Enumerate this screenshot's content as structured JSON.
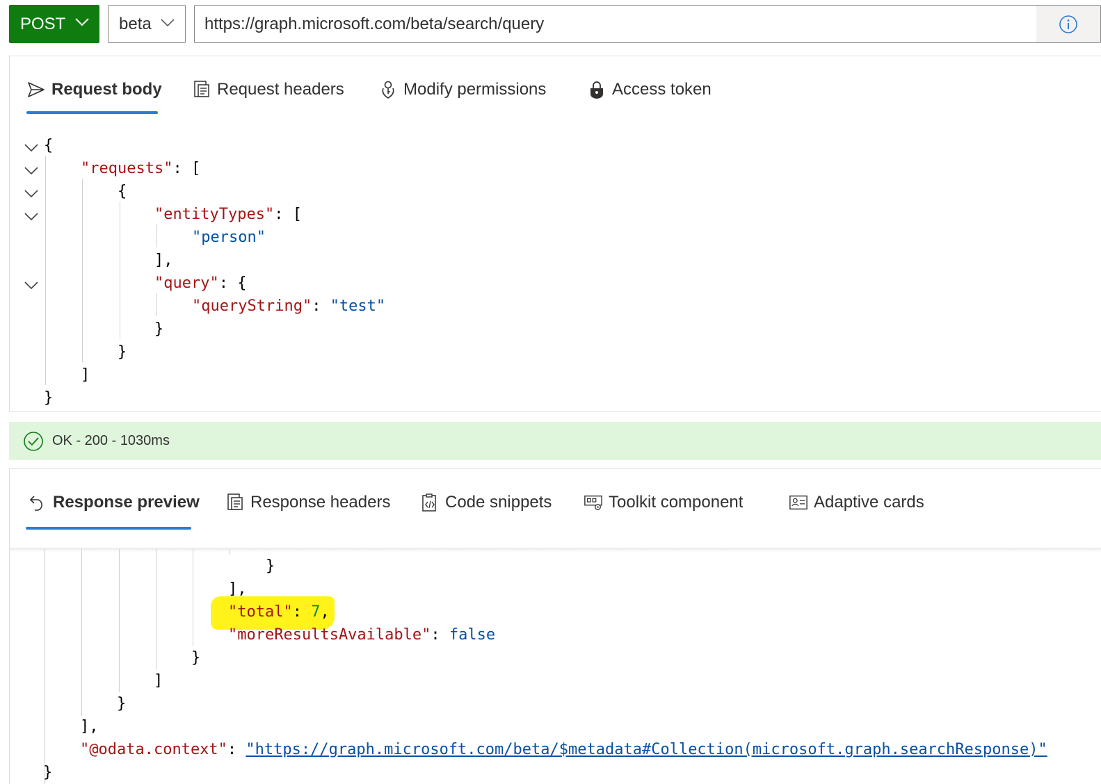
{
  "toolbar": {
    "method": "POST",
    "version": "beta",
    "url": "https://graph.microsoft.com/beta/search/query",
    "info_icon": "info-icon"
  },
  "request": {
    "tabs": [
      {
        "label": "Request body",
        "icon": "send-icon",
        "active": true
      },
      {
        "label": "Request headers",
        "icon": "document-list-icon",
        "active": false
      },
      {
        "label": "Modify permissions",
        "icon": "key-icon",
        "active": false
      },
      {
        "label": "Access token",
        "icon": "lock-icon",
        "active": false
      }
    ],
    "body_lines": [
      {
        "key": "",
        "sep": "",
        "val": "{"
      },
      {
        "key": "\"requests\"",
        "sep": ": ",
        "val": "["
      },
      {
        "key": "",
        "sep": "",
        "val": "{"
      },
      {
        "key": "\"entityTypes\"",
        "sep": ": ",
        "val": "["
      },
      {
        "key": "",
        "sep": "",
        "val": "\"person\""
      },
      {
        "key": "",
        "sep": "",
        "val": "],"
      },
      {
        "key": "\"query\"",
        "sep": ": ",
        "val": "{"
      },
      {
        "key": "\"queryString\"",
        "sep": ": ",
        "val": "\"test\""
      },
      {
        "key": "",
        "sep": "",
        "val": "}"
      },
      {
        "key": "",
        "sep": "",
        "val": "}"
      },
      {
        "key": "",
        "sep": "",
        "val": "]"
      },
      {
        "key": "",
        "sep": "",
        "val": "}"
      }
    ]
  },
  "status": {
    "text": "OK - 200 - 1030ms",
    "color": "#dff6dd"
  },
  "response": {
    "tabs": [
      {
        "label": "Response preview",
        "icon": "undo-arrow-icon",
        "active": true
      },
      {
        "label": "Response headers",
        "icon": "document-list-icon",
        "active": false
      },
      {
        "label": "Code snippets",
        "icon": "clipboard-code-icon",
        "active": false
      },
      {
        "label": "Toolkit component",
        "icon": "toolkit-icon",
        "active": false
      },
      {
        "label": "Adaptive cards",
        "icon": "contact-card-icon",
        "active": false
      }
    ],
    "lines": {
      "l1": "}",
      "l2": "],",
      "total_key": "\"total\"",
      "total_val": "7",
      "more_key": "\"moreResultsAvailable\"",
      "more_val": "false",
      "l5": "}",
      "l6": "]",
      "l7": "}",
      "l8": "],",
      "context_key": "\"@odata.context\"",
      "context_val": "\"https://graph.microsoft.com/beta/$metadata#Collection(microsoft.graph.searchResponse)\"",
      "l10": "}"
    }
  },
  "colors": {
    "method_bg": "#107c10",
    "accent": "#2b7cd3",
    "json_key": "#a31515",
    "json_string": "#0451a5",
    "json_number": "#098658",
    "highlight": "#fff200"
  }
}
